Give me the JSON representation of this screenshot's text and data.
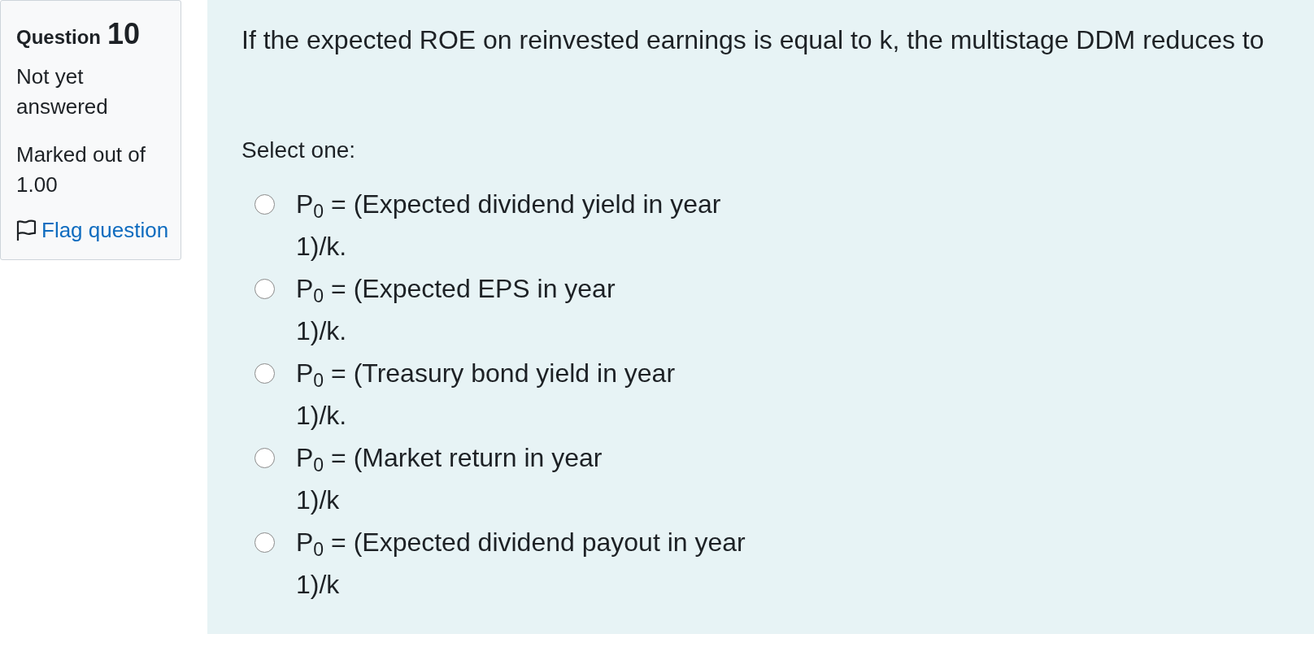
{
  "info": {
    "label": "Question",
    "number": "10",
    "state": "Not yet answered",
    "mark": "Marked out of 1.00",
    "flag": {
      "label": "Flag question",
      "flagged": false
    }
  },
  "question": {
    "text": "If the expected ROE on reinvested earnings is equal to k, the multistage DDM reduces to",
    "prompt": "Select one:"
  },
  "options": [
    {
      "lines": [
        "P$_{0}$ = (Expected dividend yield in year",
        "1)/k."
      ],
      "selected": false
    },
    {
      "lines": [
        "P$_{0}$ = (Expected EPS in year",
        "1)/k."
      ],
      "selected": false
    },
    {
      "lines": [
        "P$_{0}$ = (Treasury bond yield in year",
        "1)/k."
      ],
      "selected": false
    },
    {
      "lines": [
        "P$_{0}$ = (Market return in year",
        "1)/k"
      ],
      "selected": false
    },
    {
      "lines": [
        "P$_{0}$ = (Expected dividend payout in year",
        "1)/k"
      ],
      "selected": false
    }
  ]
}
